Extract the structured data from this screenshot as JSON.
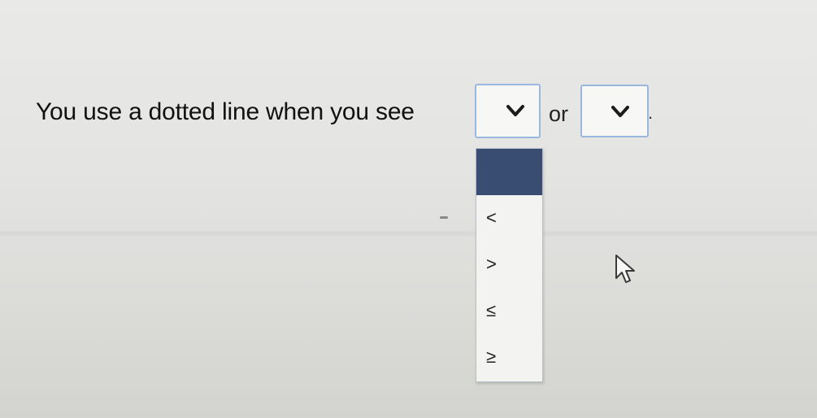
{
  "question": {
    "prefix": "You use a dotted line when you see",
    "connector": "or",
    "suffix": "."
  },
  "dropdown": {
    "selected_index": 0,
    "options": [
      "",
      "<",
      ">",
      "≤",
      "≥"
    ]
  },
  "icons": {
    "select_arrow": "chevron-down-icon",
    "pointer": "mouse-pointer-icon"
  }
}
